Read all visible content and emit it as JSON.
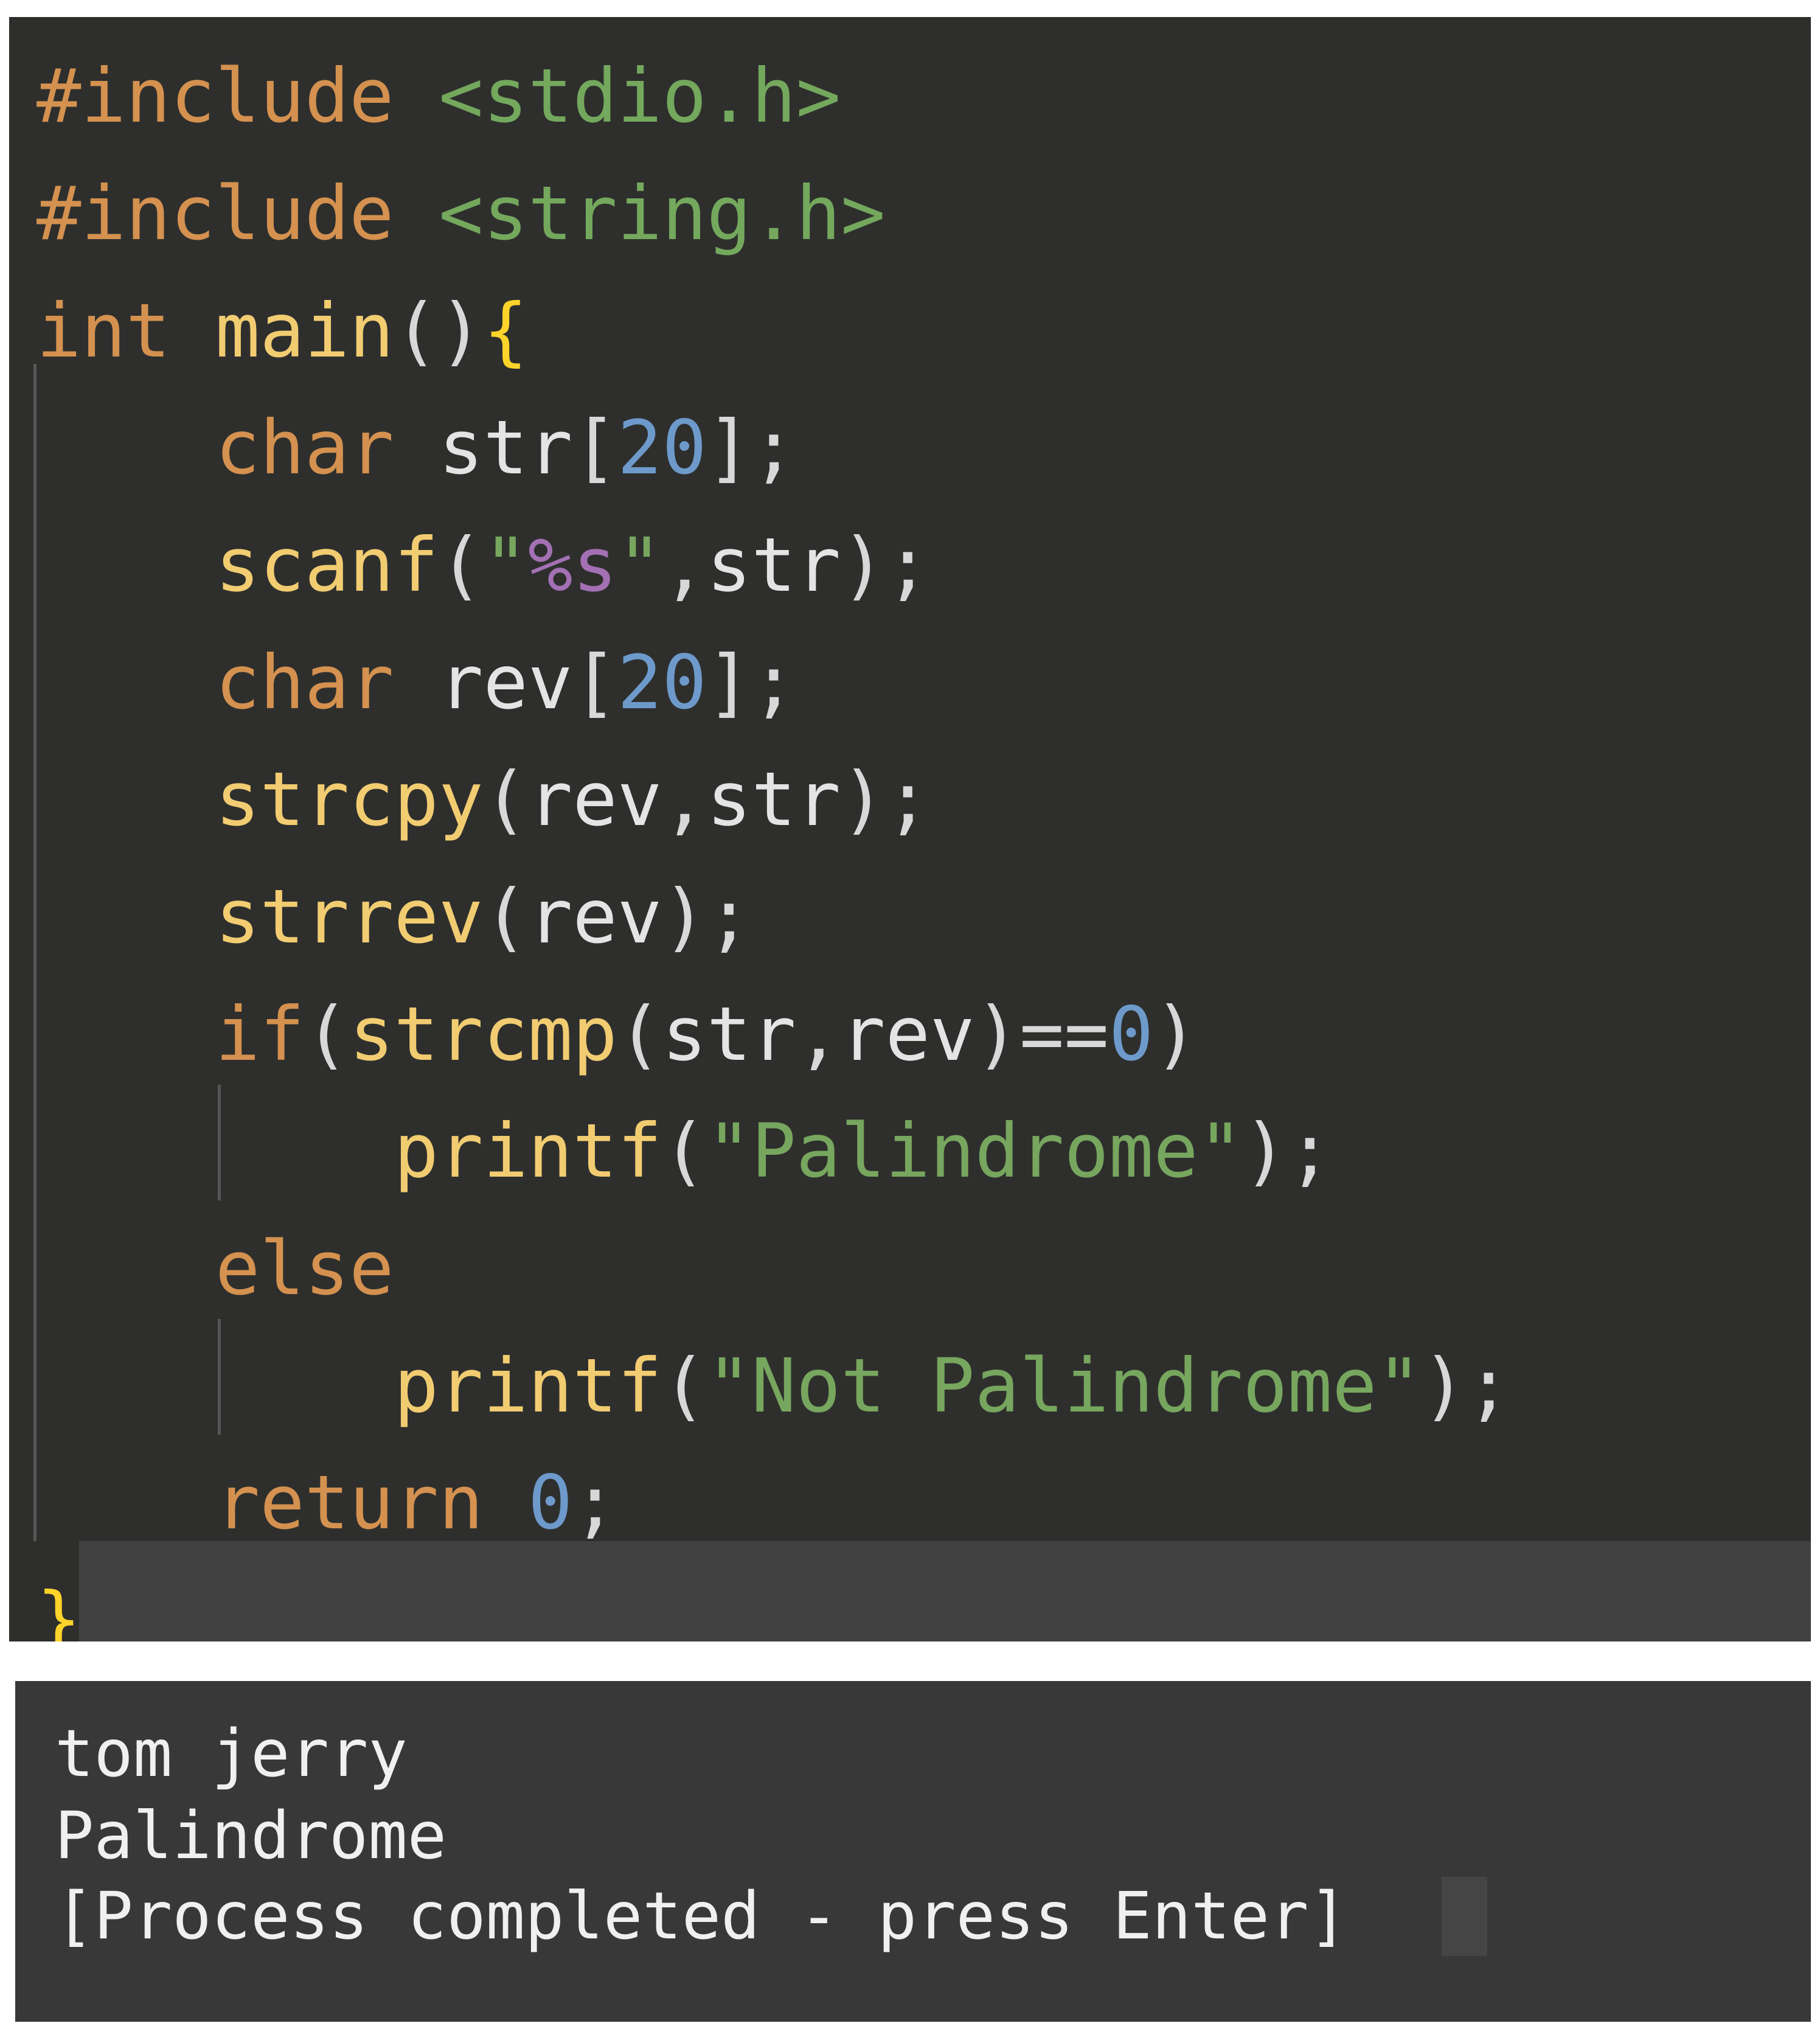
{
  "editor": {
    "lines": [
      [
        {
          "t": "#include ",
          "c": "keyword"
        },
        {
          "t": "<stdio.h>",
          "c": "header"
        }
      ],
      [
        {
          "t": "#include ",
          "c": "keyword"
        },
        {
          "t": "<string.h>",
          "c": "header"
        }
      ],
      [
        {
          "t": "int ",
          "c": "keyword"
        },
        {
          "t": "main",
          "c": "func"
        },
        {
          "t": "()",
          "c": "punct"
        },
        {
          "t": "{",
          "c": "brace"
        }
      ],
      [
        {
          "t": "    ",
          "c": "ident"
        },
        {
          "t": "char ",
          "c": "keyword"
        },
        {
          "t": "str",
          "c": "ident"
        },
        {
          "t": "[",
          "c": "punct"
        },
        {
          "t": "20",
          "c": "number"
        },
        {
          "t": "];",
          "c": "punct"
        }
      ],
      [
        {
          "t": "    ",
          "c": "ident"
        },
        {
          "t": "scanf",
          "c": "func"
        },
        {
          "t": "(",
          "c": "punct"
        },
        {
          "t": "\"",
          "c": "string"
        },
        {
          "t": "%s",
          "c": "format"
        },
        {
          "t": "\"",
          "c": "string"
        },
        {
          "t": ",",
          "c": "punct"
        },
        {
          "t": "str",
          "c": "ident"
        },
        {
          "t": ");",
          "c": "punct"
        }
      ],
      [
        {
          "t": "    ",
          "c": "ident"
        },
        {
          "t": "char ",
          "c": "keyword"
        },
        {
          "t": "rev",
          "c": "ident"
        },
        {
          "t": "[",
          "c": "punct"
        },
        {
          "t": "20",
          "c": "number"
        },
        {
          "t": "];",
          "c": "punct"
        }
      ],
      [
        {
          "t": "    ",
          "c": "ident"
        },
        {
          "t": "strcpy",
          "c": "func"
        },
        {
          "t": "(",
          "c": "punct"
        },
        {
          "t": "rev",
          "c": "ident"
        },
        {
          "t": ",",
          "c": "punct"
        },
        {
          "t": "str",
          "c": "ident"
        },
        {
          "t": ");",
          "c": "punct"
        }
      ],
      [
        {
          "t": "    ",
          "c": "ident"
        },
        {
          "t": "strrev",
          "c": "func"
        },
        {
          "t": "(",
          "c": "punct"
        },
        {
          "t": "rev",
          "c": "ident"
        },
        {
          "t": ");",
          "c": "punct"
        }
      ],
      [
        {
          "t": "    ",
          "c": "ident"
        },
        {
          "t": "if",
          "c": "keyword"
        },
        {
          "t": "(",
          "c": "punct"
        },
        {
          "t": "strcmp",
          "c": "func"
        },
        {
          "t": "(",
          "c": "punct"
        },
        {
          "t": "str",
          "c": "ident"
        },
        {
          "t": ",",
          "c": "punct"
        },
        {
          "t": "rev",
          "c": "ident"
        },
        {
          "t": ")==",
          "c": "punct"
        },
        {
          "t": "0",
          "c": "number"
        },
        {
          "t": ")",
          "c": "punct"
        }
      ],
      [
        {
          "t": "        ",
          "c": "ident"
        },
        {
          "t": "printf",
          "c": "func"
        },
        {
          "t": "(",
          "c": "punct"
        },
        {
          "t": "\"Palindrome\"",
          "c": "string"
        },
        {
          "t": ");",
          "c": "punct"
        }
      ],
      [
        {
          "t": "    ",
          "c": "ident"
        },
        {
          "t": "else",
          "c": "keyword"
        }
      ],
      [
        {
          "t": "        ",
          "c": "ident"
        },
        {
          "t": "printf",
          "c": "func"
        },
        {
          "t": "(",
          "c": "punct"
        },
        {
          "t": "\"Not Palindrome\"",
          "c": "string"
        },
        {
          "t": ");",
          "c": "punct"
        }
      ],
      [
        {
          "t": "    ",
          "c": "ident"
        },
        {
          "t": "return ",
          "c": "keyword"
        },
        {
          "t": "0",
          "c": "number"
        },
        {
          "t": ";",
          "c": "punct"
        }
      ],
      [
        {
          "t": "}",
          "c": "brace"
        }
      ]
    ]
  },
  "terminal": {
    "input": "tom jerry",
    "output": "Palindrome",
    "status": "[Process completed - press Enter]"
  }
}
